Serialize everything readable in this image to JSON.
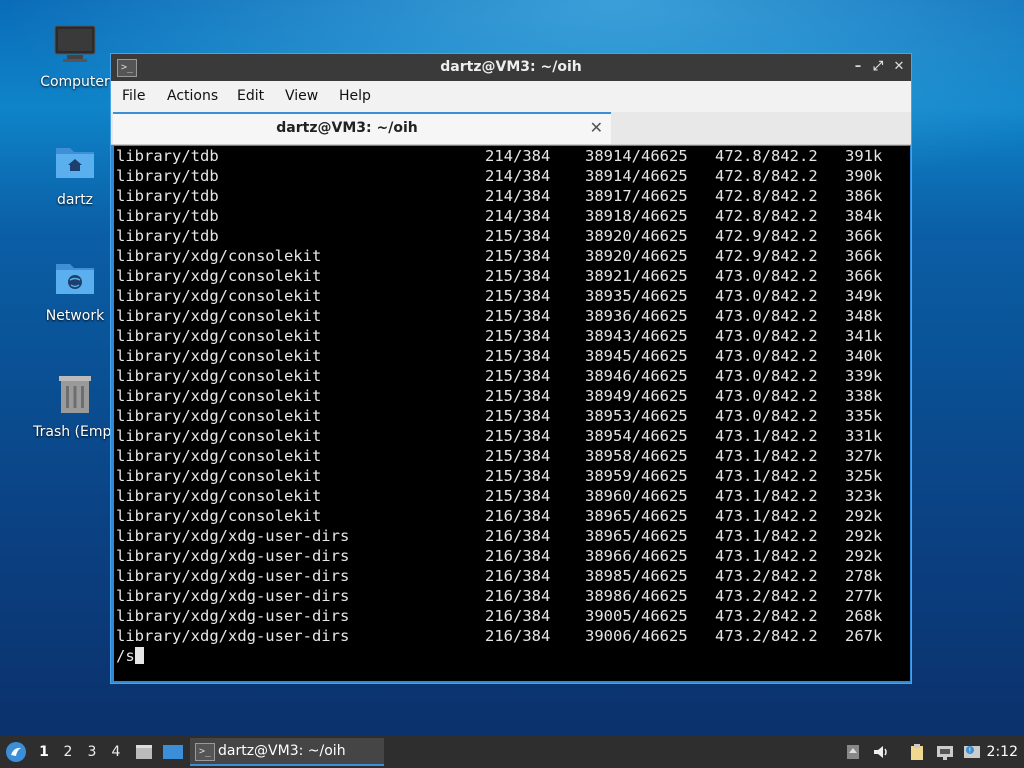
{
  "desktop": {
    "icons": [
      {
        "label": "Computer",
        "icon": "computer-icon"
      },
      {
        "label": "dartz",
        "icon": "home-folder-icon"
      },
      {
        "label": "Network",
        "icon": "network-folder-icon"
      },
      {
        "label": "Trash (Empt",
        "icon": "trash-icon"
      }
    ]
  },
  "window": {
    "title": "dartz@VM3: ~/oih",
    "menu": [
      "File",
      "Actions",
      "Edit",
      "View",
      "Help"
    ],
    "tab_title": "dartz@VM3: ~/oih",
    "terminal": {
      "rows": [
        {
          "path": "library/tdb",
          "pkgs": "214/384",
          "files": "38914/46625",
          "size": "472.8/842.2",
          "rate": "391k"
        },
        {
          "path": "library/tdb",
          "pkgs": "214/384",
          "files": "38914/46625",
          "size": "472.8/842.2",
          "rate": "390k"
        },
        {
          "path": "library/tdb",
          "pkgs": "214/384",
          "files": "38917/46625",
          "size": "472.8/842.2",
          "rate": "386k"
        },
        {
          "path": "library/tdb",
          "pkgs": "214/384",
          "files": "38918/46625",
          "size": "472.8/842.2",
          "rate": "384k"
        },
        {
          "path": "library/tdb",
          "pkgs": "215/384",
          "files": "38920/46625",
          "size": "472.9/842.2",
          "rate": "366k"
        },
        {
          "path": "library/xdg/consolekit",
          "pkgs": "215/384",
          "files": "38920/46625",
          "size": "472.9/842.2",
          "rate": "366k"
        },
        {
          "path": "library/xdg/consolekit",
          "pkgs": "215/384",
          "files": "38921/46625",
          "size": "473.0/842.2",
          "rate": "366k"
        },
        {
          "path": "library/xdg/consolekit",
          "pkgs": "215/384",
          "files": "38935/46625",
          "size": "473.0/842.2",
          "rate": "349k"
        },
        {
          "path": "library/xdg/consolekit",
          "pkgs": "215/384",
          "files": "38936/46625",
          "size": "473.0/842.2",
          "rate": "348k"
        },
        {
          "path": "library/xdg/consolekit",
          "pkgs": "215/384",
          "files": "38943/46625",
          "size": "473.0/842.2",
          "rate": "341k"
        },
        {
          "path": "library/xdg/consolekit",
          "pkgs": "215/384",
          "files": "38945/46625",
          "size": "473.0/842.2",
          "rate": "340k"
        },
        {
          "path": "library/xdg/consolekit",
          "pkgs": "215/384",
          "files": "38946/46625",
          "size": "473.0/842.2",
          "rate": "339k"
        },
        {
          "path": "library/xdg/consolekit",
          "pkgs": "215/384",
          "files": "38949/46625",
          "size": "473.0/842.2",
          "rate": "338k"
        },
        {
          "path": "library/xdg/consolekit",
          "pkgs": "215/384",
          "files": "38953/46625",
          "size": "473.0/842.2",
          "rate": "335k"
        },
        {
          "path": "library/xdg/consolekit",
          "pkgs": "215/384",
          "files": "38954/46625",
          "size": "473.1/842.2",
          "rate": "331k"
        },
        {
          "path": "library/xdg/consolekit",
          "pkgs": "215/384",
          "files": "38958/46625",
          "size": "473.1/842.2",
          "rate": "327k"
        },
        {
          "path": "library/xdg/consolekit",
          "pkgs": "215/384",
          "files": "38959/46625",
          "size": "473.1/842.2",
          "rate": "325k"
        },
        {
          "path": "library/xdg/consolekit",
          "pkgs": "215/384",
          "files": "38960/46625",
          "size": "473.1/842.2",
          "rate": "323k"
        },
        {
          "path": "library/xdg/consolekit",
          "pkgs": "216/384",
          "files": "38965/46625",
          "size": "473.1/842.2",
          "rate": "292k"
        },
        {
          "path": "library/xdg/xdg-user-dirs",
          "pkgs": "216/384",
          "files": "38965/46625",
          "size": "473.1/842.2",
          "rate": "292k"
        },
        {
          "path": "library/xdg/xdg-user-dirs",
          "pkgs": "216/384",
          "files": "38966/46625",
          "size": "473.1/842.2",
          "rate": "292k"
        },
        {
          "path": "library/xdg/xdg-user-dirs",
          "pkgs": "216/384",
          "files": "38985/46625",
          "size": "473.2/842.2",
          "rate": "278k"
        },
        {
          "path": "library/xdg/xdg-user-dirs",
          "pkgs": "216/384",
          "files": "38986/46625",
          "size": "473.2/842.2",
          "rate": "277k"
        },
        {
          "path": "library/xdg/xdg-user-dirs",
          "pkgs": "216/384",
          "files": "39005/46625",
          "size": "473.2/842.2",
          "rate": "268k"
        },
        {
          "path": "library/xdg/xdg-user-dirs",
          "pkgs": "216/384",
          "files": "39006/46625",
          "size": "473.2/842.2",
          "rate": "267k"
        }
      ],
      "prompt": "/s"
    }
  },
  "taskbar": {
    "workspaces": [
      "1",
      "2",
      "3",
      "4"
    ],
    "active_workspace": "1",
    "task_title": "dartz@VM3: ~/oih",
    "clock": "2:12"
  },
  "colors": {
    "accent": "#3b8fd9",
    "terminal_bg": "#000000",
    "terminal_fg": "#e6e6e6",
    "titlebar": "#3a3a3a",
    "taskbar": "#2e2e2e"
  }
}
